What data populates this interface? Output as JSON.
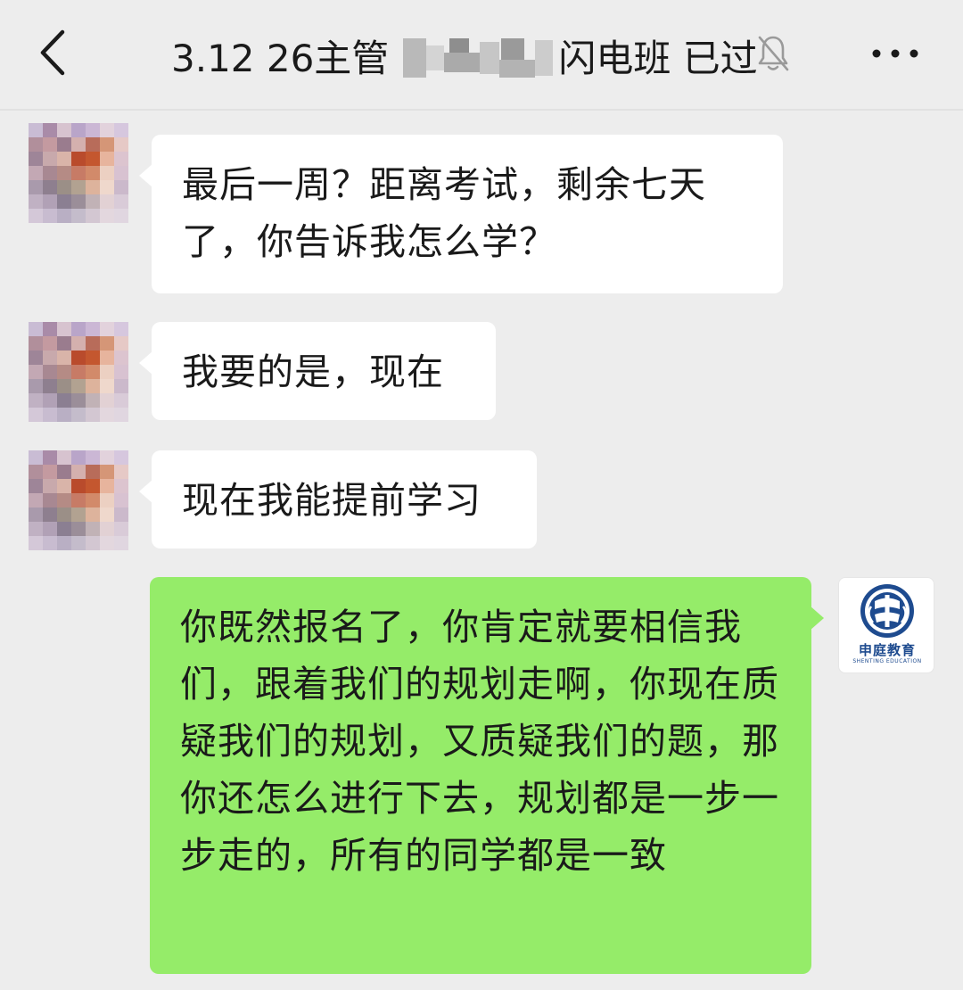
{
  "header": {
    "title_prefix": "3.12 26主管",
    "title_suffix": "闪电班 已过",
    "back_icon": "chevron-left-icon",
    "mute_icon": "bell-off-icon",
    "more_icon": "more-horizontal-icon"
  },
  "messages": [
    {
      "side": "left",
      "text": "最后一周？距离考试，剩余七天了，你告诉我怎么学？"
    },
    {
      "side": "left",
      "text": "我要的是，现在"
    },
    {
      "side": "left",
      "text": "现在我能提前学习"
    },
    {
      "side": "right",
      "text": "你既然报名了，你肯定就要相信我们，跟着我们的规划走啊，你现在质疑我们的规划，又质疑我们的题，那你还怎么进行下去，规划都是一步一步走的，所有的同学都是一致"
    }
  ],
  "self_avatar": {
    "name": "申庭教育",
    "sub": "SHENTING EDUCATION"
  },
  "colors": {
    "background": "#ededed",
    "bubble_left": "#ffffff",
    "bubble_right": "#95ec69",
    "text": "#1a1a1a",
    "logo_blue": "#1e4b8f"
  }
}
